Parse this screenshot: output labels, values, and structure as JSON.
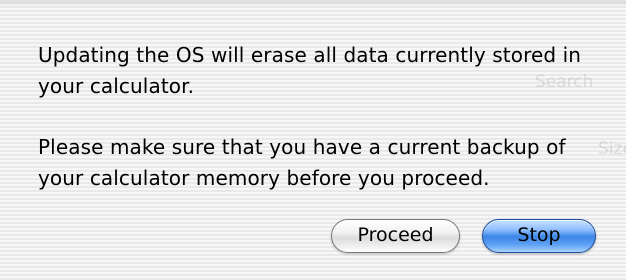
{
  "dialog": {
    "message_line_1": "Updating the OS will erase all data currently stored in your calculator.",
    "message_line_2": "Please make sure that you have a current backup of your calculator memory before you proceed."
  },
  "buttons": {
    "proceed_label": "Proceed",
    "stop_label": "Stop"
  },
  "background_ghost": {
    "search_label": "Search",
    "size_label": "Size"
  },
  "colors": {
    "default_button_blue": "#3d86e6",
    "default_button_border": "#1d4f9c",
    "secondary_button_border": "#7a7a7a",
    "pinstripe_light": "#f7f7f7",
    "pinstripe_dark": "#e9e9e9"
  }
}
